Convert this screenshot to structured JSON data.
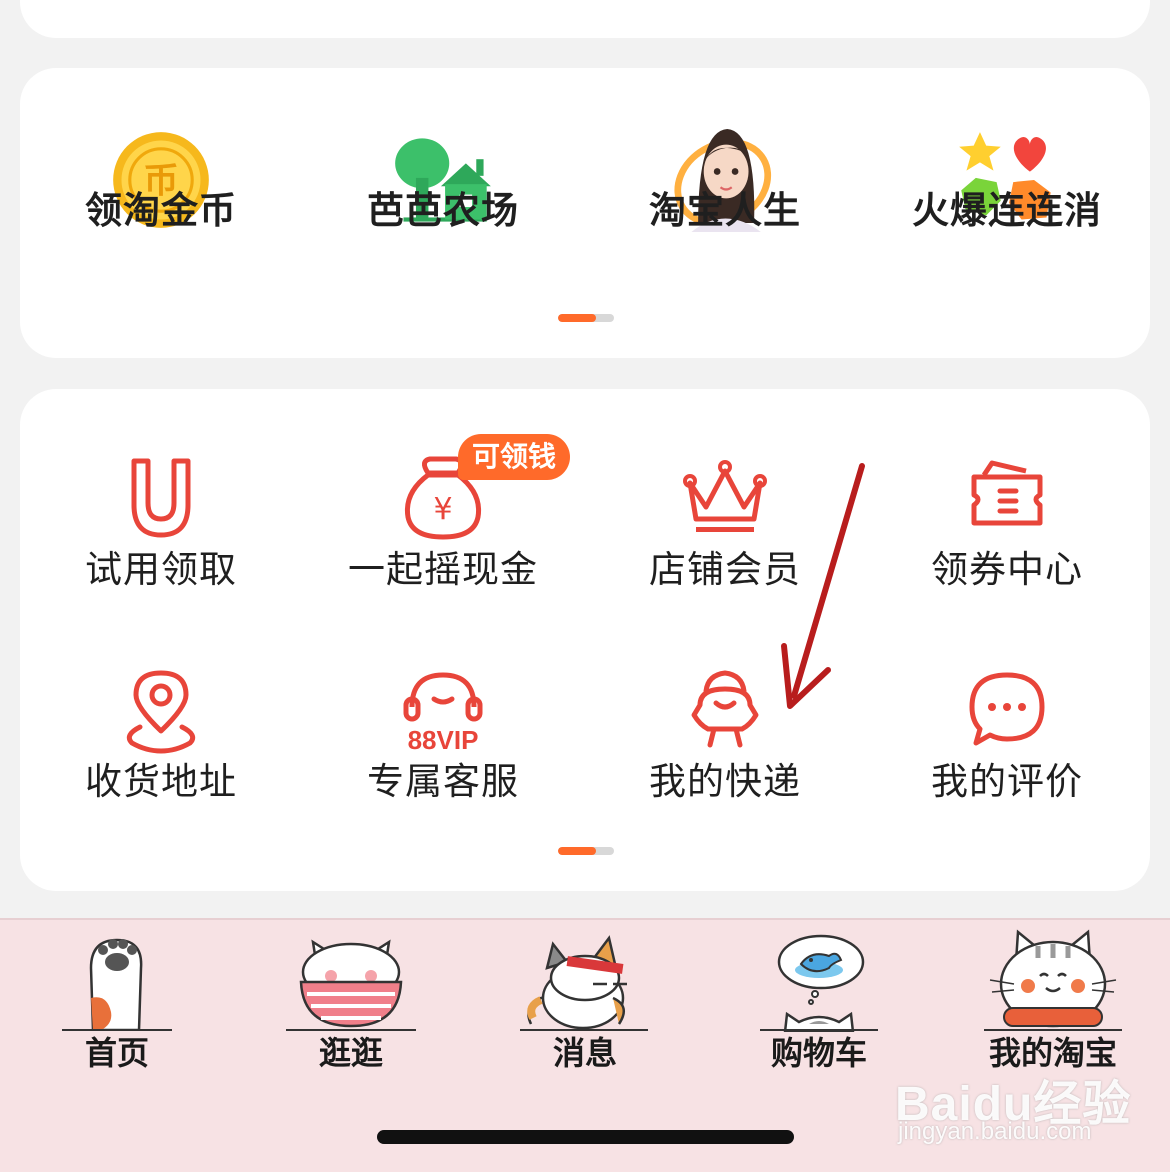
{
  "games": {
    "items": [
      {
        "label": "领淘金币",
        "icon": "gold-coin-icon"
      },
      {
        "label": "芭芭农场",
        "icon": "farm-tree-house-icon"
      },
      {
        "label": "淘宝人生",
        "icon": "avatar-girl-icon"
      },
      {
        "label": "火爆连连消",
        "icon": "match-shapes-icon"
      }
    ],
    "coin_glyph": "币"
  },
  "services": {
    "items": [
      {
        "label": "试用领取",
        "icon": "trial-u-icon"
      },
      {
        "label": "一起摇现金",
        "icon": "money-bag-icon"
      },
      {
        "label": "店铺会员",
        "icon": "crown-icon"
      },
      {
        "label": "领券中心",
        "icon": "coupon-icon"
      },
      {
        "label": "收货地址",
        "icon": "location-pin-icon"
      },
      {
        "label": "专属客服",
        "icon": "headset-88vip-icon"
      },
      {
        "label": "我的快递",
        "icon": "courier-bird-icon"
      },
      {
        "label": "我的评价",
        "icon": "chat-bubble-icon"
      }
    ],
    "badge": "可领钱",
    "vip_text": "88VIP",
    "yen": "¥"
  },
  "tabbar": {
    "tabs": [
      {
        "label": "首页",
        "icon": "cat-paw-icon"
      },
      {
        "label": "逛逛",
        "icon": "cat-bowl-icon"
      },
      {
        "label": "消息",
        "icon": "sleeping-cat-icon"
      },
      {
        "label": "购物车",
        "icon": "cat-fish-dream-icon"
      },
      {
        "label": "我的淘宝",
        "icon": "cat-face-icon"
      }
    ]
  },
  "watermark": {
    "logo": "Baidu经验",
    "url": "jingyan.baidu.com"
  },
  "colors": {
    "accent": "#ff6a2a",
    "icon_red": "#e8453a",
    "tabbar_bg": "#f7e2e4",
    "annotation_arrow": "#b81d1d"
  }
}
